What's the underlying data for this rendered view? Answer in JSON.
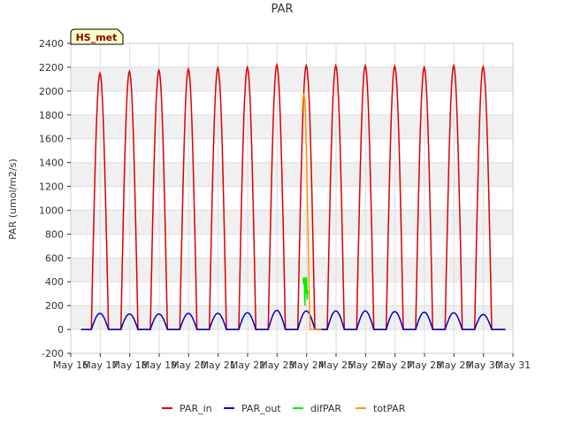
{
  "chart_data": {
    "type": "line",
    "title": "PAR",
    "ylabel": "PAR (umol/m2/s)",
    "xlabel": "",
    "badge": "HS_met",
    "ylim": [
      -200,
      2400
    ],
    "yticks": [
      -200,
      0,
      200,
      400,
      600,
      800,
      1000,
      1200,
      1400,
      1600,
      1800,
      2000,
      2200,
      2400
    ],
    "xlim": [
      16,
      31
    ],
    "xticks": [
      {
        "x": 16,
        "label": "May 16"
      },
      {
        "x": 17,
        "label": "May 17"
      },
      {
        "x": 18,
        "label": "May 18"
      },
      {
        "x": 19,
        "label": "May 19"
      },
      {
        "x": 20,
        "label": "May 20"
      },
      {
        "x": 21,
        "label": "May 21"
      },
      {
        "x": 22,
        "label": "May 22"
      },
      {
        "x": 23,
        "label": "May 23"
      },
      {
        "x": 24,
        "label": "May 24"
      },
      {
        "x": 25,
        "label": "May 25"
      },
      {
        "x": 26,
        "label": "May 26"
      },
      {
        "x": 27,
        "label": "May 27"
      },
      {
        "x": 28,
        "label": "May 28"
      },
      {
        "x": 29,
        "label": "May 29"
      },
      {
        "x": 30,
        "label": "May 30"
      },
      {
        "x": 31,
        "label": "May 31"
      }
    ],
    "grid": true,
    "legend_position": "bottom",
    "series": [
      {
        "name": "PAR_in",
        "color": "#dd0000",
        "days": [
          {
            "start": 16.7,
            "peak": 2150
          },
          {
            "start": 17.7,
            "peak": 2165
          },
          {
            "start": 18.7,
            "peak": 2175
          },
          {
            "start": 19.7,
            "peak": 2185
          },
          {
            "start": 20.7,
            "peak": 2195
          },
          {
            "start": 21.7,
            "peak": 2200
          },
          {
            "start": 22.7,
            "peak": 2220
          },
          {
            "start": 23.7,
            "peak": 2215
          },
          {
            "start": 24.7,
            "peak": 2215
          },
          {
            "start": 25.7,
            "peak": 2215
          },
          {
            "start": 26.7,
            "peak": 2210
          },
          {
            "start": 27.7,
            "peak": 2200
          },
          {
            "start": 28.7,
            "peak": 2215
          },
          {
            "start": 29.7,
            "peak": 2205
          }
        ],
        "day_length": 0.58
      },
      {
        "name": "PAR_out",
        "color": "#0000cc",
        "days": [
          {
            "start": 16.7,
            "peak": 135
          },
          {
            "start": 17.7,
            "peak": 130
          },
          {
            "start": 18.7,
            "peak": 130
          },
          {
            "start": 19.7,
            "peak": 135
          },
          {
            "start": 20.7,
            "peak": 135
          },
          {
            "start": 21.7,
            "peak": 140
          },
          {
            "start": 22.7,
            "peak": 160
          },
          {
            "start": 23.7,
            "peak": 155
          },
          {
            "start": 24.7,
            "peak": 155
          },
          {
            "start": 25.7,
            "peak": 155
          },
          {
            "start": 26.7,
            "peak": 150
          },
          {
            "start": 27.7,
            "peak": 145
          },
          {
            "start": 28.7,
            "peak": 140
          },
          {
            "start": 29.7,
            "peak": 125
          }
        ],
        "day_length": 0.58,
        "span": [
          16.35,
          30.75
        ]
      },
      {
        "name": "difPAR",
        "color": "#00ee00",
        "points": [
          [
            23.88,
            430
          ],
          [
            23.9,
            380
          ],
          [
            23.92,
            440
          ],
          [
            23.94,
            200
          ],
          [
            23.96,
            430
          ],
          [
            23.98,
            300
          ],
          [
            24.0,
            440
          ],
          [
            24.02,
            250
          ],
          [
            24.04,
            330
          ]
        ]
      },
      {
        "name": "totPAR",
        "color": "#ff9900",
        "points": [
          [
            23.85,
            1820
          ],
          [
            23.88,
            1950
          ],
          [
            23.91,
            1980
          ],
          [
            23.95,
            1900
          ],
          [
            24.0,
            1400
          ],
          [
            24.05,
            800
          ],
          [
            24.1,
            200
          ],
          [
            24.12,
            0
          ],
          [
            24.5,
            0
          ]
        ]
      }
    ]
  }
}
